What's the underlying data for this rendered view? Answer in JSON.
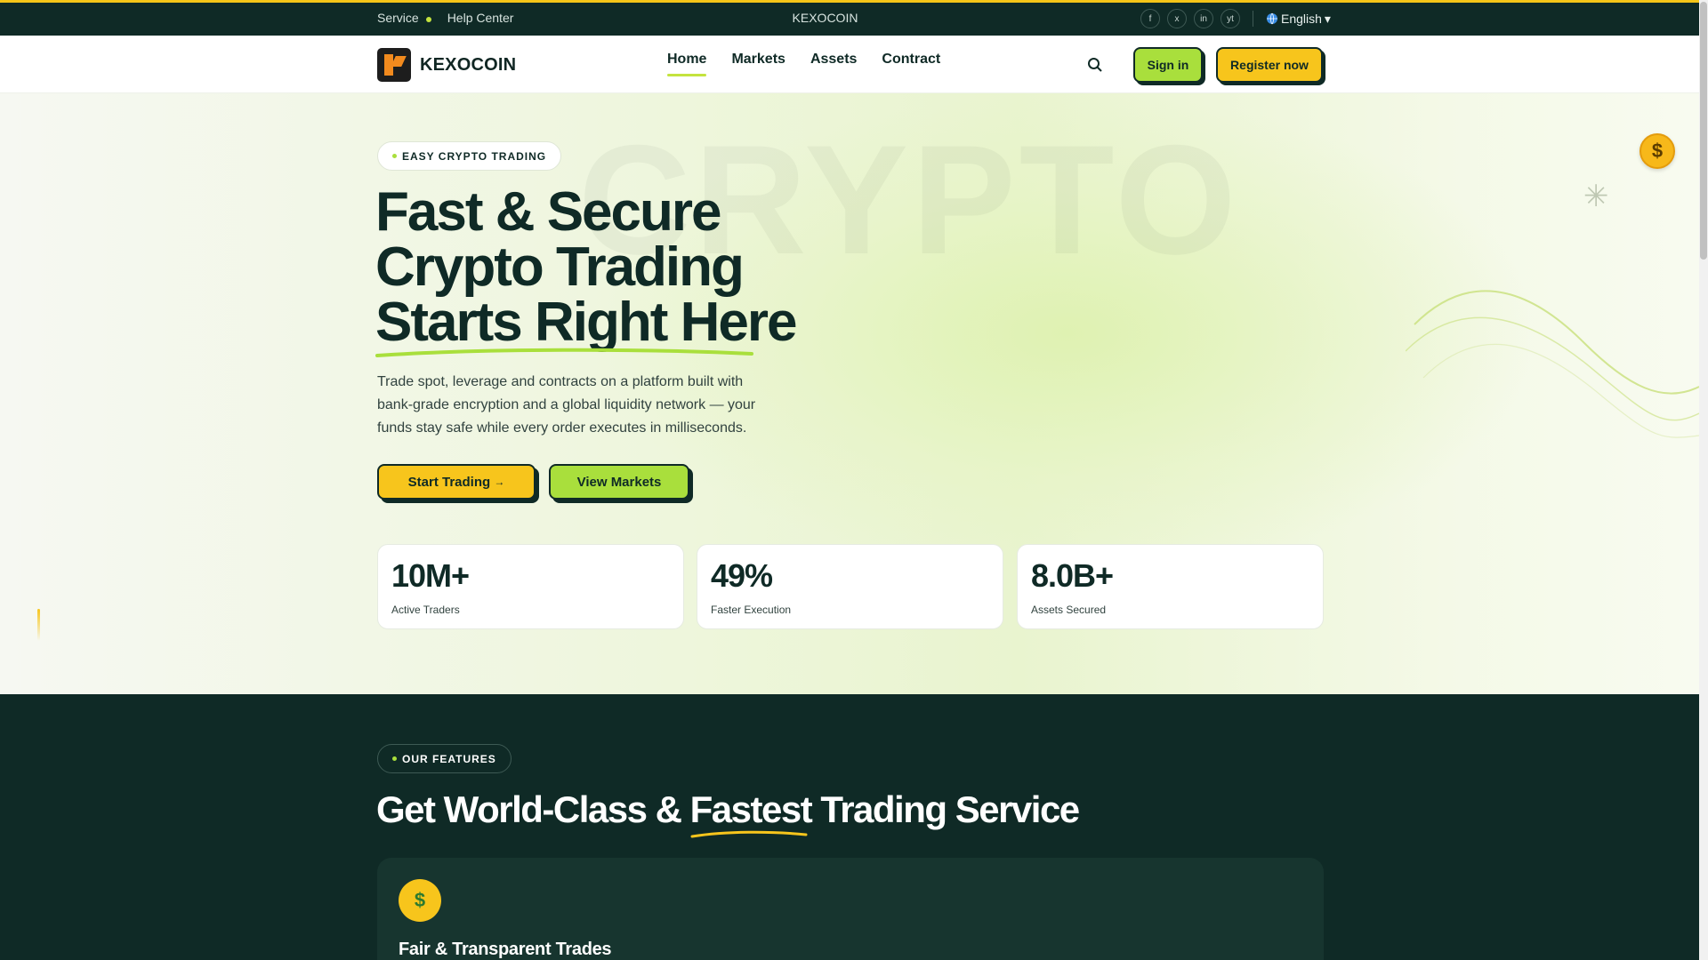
{
  "topbar": {
    "service": "Service",
    "help": "Help Center",
    "brand": "KEXOCOIN",
    "socials": [
      "f",
      "x",
      "in",
      "yt"
    ],
    "language": "English",
    "language_icon": "globe-icon"
  },
  "nav": {
    "logo_text": "KEXOCOIN",
    "items": [
      "Home",
      "Markets",
      "Assets",
      "Contract"
    ],
    "active": "Home",
    "search_icon": "search-icon",
    "sign_in": "Sign in",
    "register": "Register now"
  },
  "hero": {
    "badge": "EASY CRYPTO TRADING",
    "watermark": "CRYPTO",
    "headline": [
      "Fast & Secure",
      "Crypto Trading",
      "Starts Right Here"
    ],
    "lead": "Trade spot, leverage and contracts on a platform built with bank-grade encryption and a global liquidity network — your funds stay safe while every order executes in milliseconds.",
    "cta_primary": "Start Trading",
    "cta_primary_arrow": "→",
    "cta_secondary": "View Markets",
    "stats": [
      {
        "value": "10M+",
        "label": "Active Traders"
      },
      {
        "value": "49%",
        "label": "Faster Execution"
      },
      {
        "value": "8.0B+",
        "label": "Assets Secured"
      }
    ],
    "coin_symbol": "$"
  },
  "features": {
    "badge": "OUR FEATURES",
    "title_before": "Get World-Class & ",
    "title_highlight": "Fastest",
    "title_after": " Trading Service",
    "card_title": "Fair & Transparent Trades",
    "card_icon": "exchange-icon"
  },
  "colors": {
    "dark": "#0f2a26",
    "lime": "#a9df3c",
    "yellow": "#f7c51c"
  }
}
